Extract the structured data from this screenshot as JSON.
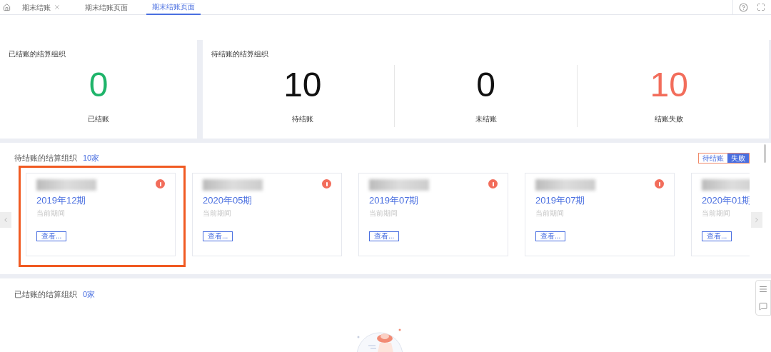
{
  "tabs": [
    {
      "label": "期末结账",
      "selected": false,
      "closable": true
    },
    {
      "label": "期末结账页面",
      "selected": false,
      "closable": false
    },
    {
      "label": "期末结账页面",
      "selected": true,
      "closable": false
    }
  ],
  "closed_summary": {
    "title": "已结账的结算组织",
    "stats": [
      {
        "value": "0",
        "label": "已结账",
        "color": "#1fb46a"
      }
    ]
  },
  "pending_summary": {
    "title": "待结账的结算组织",
    "stats": [
      {
        "value": "10",
        "label": "待结账",
        "color": "#111111"
      },
      {
        "value": "0",
        "label": "未结账",
        "color": "#111111"
      },
      {
        "value": "10",
        "label": "结账失败",
        "color": "#f26d5b"
      }
    ]
  },
  "pending_section": {
    "title": "待结账的结算组织",
    "count": "10家",
    "filters": [
      {
        "label": "待结账",
        "selected": false
      },
      {
        "label": "失败",
        "selected": true
      }
    ],
    "cards": [
      {
        "period": "2019年12期",
        "caption": "当前期间",
        "button": "查看...",
        "warning": true,
        "highlighted": true
      },
      {
        "period": "2020年05期",
        "caption": "当前期间",
        "button": "查看...",
        "warning": true,
        "highlighted": false
      },
      {
        "period": "2019年07期",
        "caption": "当前期间",
        "button": "查看...",
        "warning": true,
        "highlighted": false
      },
      {
        "period": "2019年07期",
        "caption": "当前期间",
        "button": "查看...",
        "warning": true,
        "highlighted": false
      },
      {
        "period": "2020年01期",
        "caption": "当前期间",
        "button": "查看..."
      }
    ]
  },
  "closed_section": {
    "title": "已结账的结算组织",
    "count": "0家"
  }
}
